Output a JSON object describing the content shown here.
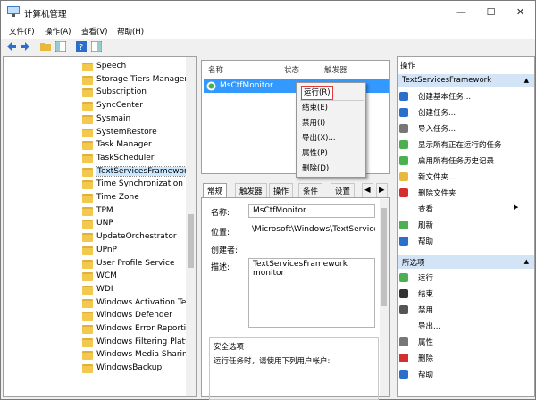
{
  "window": {
    "title": "计算机管理",
    "controls": {
      "minimize": "—",
      "maximize": "☐",
      "close": "✕"
    }
  },
  "menubar": [
    "文件(F)",
    "操作(A)",
    "查看(V)",
    "帮助(H)"
  ],
  "tree": {
    "items": [
      "Speech",
      "Storage Tiers Managen",
      "Subscription",
      "SyncCenter",
      "Sysmain",
      "SystemRestore",
      "Task Manager",
      "TaskScheduler",
      "TextServicesFramework",
      "Time Synchronization",
      "Time Zone",
      "TPM",
      "UNP",
      "UpdateOrchestrator",
      "UPnP",
      "User Profile Service",
      "WCM",
      "WDI",
      "Windows Activation Tec",
      "Windows Defender",
      "Windows Error Reporti",
      "Windows Filtering Platf",
      "Windows Media Sharin",
      "WindowsBackup"
    ],
    "selected": "TextServicesFramework",
    "scroll_position": 0.55
  },
  "task_list": {
    "columns": [
      "名称",
      "状态",
      "触发器"
    ],
    "rows": [
      {
        "name": "MsCtfMonitor",
        "status": "",
        "trigger": ""
      }
    ]
  },
  "context_menu": [
    "运行(R)",
    "结束(E)",
    "禁用(I)",
    "导出(X)...",
    "属性(P)",
    "删除(D)"
  ],
  "detail_tabs": [
    "常规",
    "触发器",
    "操作",
    "条件",
    "设置"
  ],
  "detail": {
    "name_label": "名称:",
    "name_value": "MsCtfMonitor",
    "location_label": "位置:",
    "location_value": "\\Microsoft\\Windows\\TextServicesFramewo",
    "author_label": "创建者:",
    "desc_label": "描述:",
    "desc_value": "TextServicesFramework monitor",
    "security_label": "安全选项",
    "security_text": "运行任务时，请使用下列用户帐户:"
  },
  "actions": {
    "header": "操作",
    "section1": "TextServicesFramework",
    "items1": [
      "创建基本任务...",
      "创建任务...",
      "导入任务...",
      "显示所有正在运行的任务",
      "启用所有任务历史记录",
      "新文件夹...",
      "删除文件夹",
      "查看",
      "刷新",
      "帮助"
    ],
    "section2": "所选项",
    "items2": [
      "运行",
      "结束",
      "禁用",
      "导出...",
      "属性",
      "删除",
      "帮助"
    ]
  },
  "colors": {
    "selection": "#3399ff",
    "section_bg": "#d4e4f7",
    "folder": "#f2c94c",
    "highlight_outline": "#e53935"
  }
}
